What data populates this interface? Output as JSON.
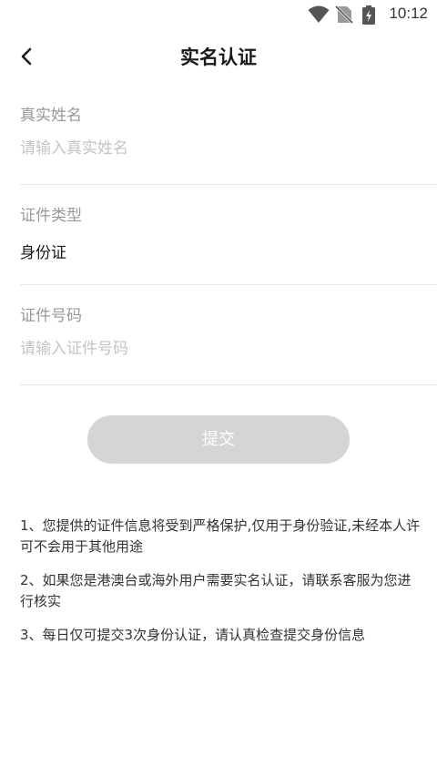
{
  "status_bar": {
    "time": "10:12",
    "icons": [
      "wifi-icon",
      "no-sim-icon",
      "battery-charging-icon"
    ]
  },
  "header": {
    "back_icon": "chevron-left-icon",
    "title": "实名认证"
  },
  "form": {
    "name": {
      "label": "真实姓名",
      "placeholder": "请输入真实姓名",
      "value": ""
    },
    "id_type": {
      "label": "证件类型",
      "value": "身份证"
    },
    "id_number": {
      "label": "证件号码",
      "placeholder": "请输入证件号码",
      "value": ""
    }
  },
  "submit": {
    "label": "提交"
  },
  "notes": [
    "1、您提供的证件信息将受到严格保护,仅用于身份验证,未经本人许可不会用于其他用途",
    "2、如果您是港澳台或海外用户需要实名认证，请联系客服为您进行核实",
    "3、每日仅可提交3次身份认证，请认真检查提交身份信息"
  ]
}
